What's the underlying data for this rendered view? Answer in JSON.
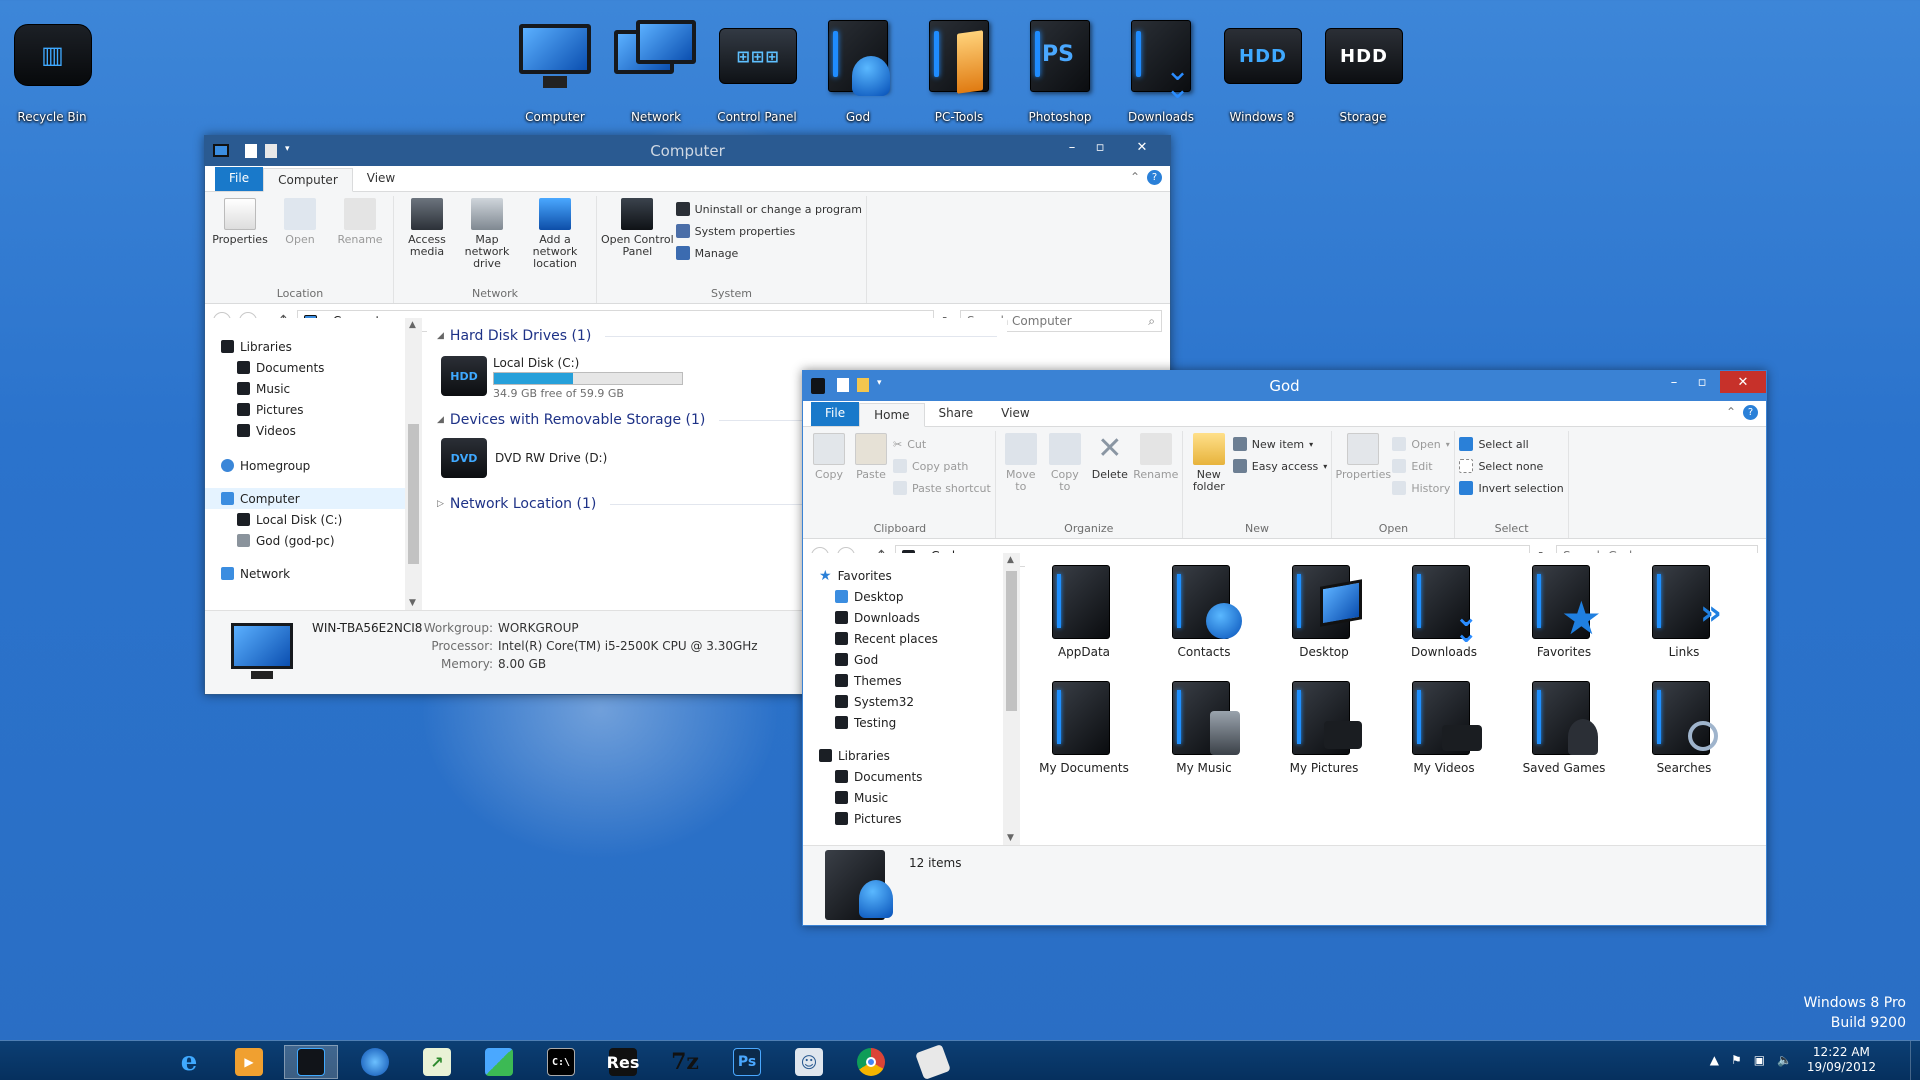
{
  "desktop": {
    "icons": [
      {
        "label": "Recycle Bin"
      },
      {
        "label": "Computer"
      },
      {
        "label": "Network"
      },
      {
        "label": "Control Panel"
      },
      {
        "label": "God"
      },
      {
        "label": "PC-Tools"
      },
      {
        "label": "Photoshop"
      },
      {
        "label": "Downloads"
      },
      {
        "label": "Windows 8"
      },
      {
        "label": "Storage"
      }
    ],
    "hdd_text": "HDD",
    "ps_text": "PS",
    "watermark_line1": "Windows 8 Pro",
    "watermark_line2": "Build 9200"
  },
  "computer_window": {
    "title": "Computer",
    "tabs": [
      "File",
      "Computer",
      "View"
    ],
    "ribbon": {
      "location": {
        "name": "Location",
        "items": [
          "Properties",
          "Open",
          "Rename"
        ]
      },
      "network": {
        "name": "Network",
        "items": [
          "Access media",
          "Map network drive",
          "Add a network location"
        ]
      },
      "system": {
        "name": "System",
        "big": "Open Control Panel",
        "small": [
          "Uninstall or change a program",
          "System properties",
          "Manage"
        ]
      }
    },
    "address": "Computer",
    "search_placeholder": "Search Computer",
    "nav": {
      "libraries": "Libraries",
      "lib_items": [
        "Documents",
        "Music",
        "Pictures",
        "Videos"
      ],
      "homegroup": "Homegroup",
      "computer": "Computer",
      "computer_items": [
        "Local Disk (C:)",
        "God (god-pc)"
      ],
      "network": "Network"
    },
    "groups": {
      "hdd": "Hard Disk Drives (1)",
      "removable": "Devices with Removable Storage (1)",
      "netloc": "Network Location (1)"
    },
    "local_disk": {
      "name": "Local Disk (C:)",
      "free_text": "34.9 GB free of 59.9 GB",
      "used_fraction": 0.42,
      "icon_text": "HDD"
    },
    "dvd": {
      "name": "DVD RW Drive (D:)",
      "icon_text": "DVD"
    },
    "details": {
      "pc_name": "WIN-TBA56E2NCI8",
      "workgroup_label": "Workgroup:",
      "workgroup": "WORKGROUP",
      "processor_label": "Processor:",
      "processor": "Intel(R) Core(TM) i5-2500K CPU @ 3.30GHz",
      "memory_label": "Memory:",
      "memory": "8.00 GB"
    }
  },
  "god_window": {
    "title": "God",
    "tabs": [
      "File",
      "Home",
      "Share",
      "View"
    ],
    "ribbon": {
      "clipboard": {
        "name": "Clipboard",
        "big": [
          "Copy",
          "Paste"
        ],
        "small": [
          "Cut",
          "Copy path",
          "Paste shortcut"
        ]
      },
      "organize": {
        "name": "Organize",
        "items": [
          "Move to",
          "Copy to",
          "Delete",
          "Rename"
        ]
      },
      "new": {
        "name": "New",
        "big": "New folder",
        "small": [
          "New item",
          "Easy access"
        ]
      },
      "open": {
        "name": "Open",
        "big": "Properties",
        "small": [
          "Open",
          "Edit",
          "History"
        ]
      },
      "select": {
        "name": "Select",
        "small": [
          "Select all",
          "Select none",
          "Invert selection"
        ]
      }
    },
    "address": "God",
    "search_placeholder": "Search God",
    "nav": {
      "favorites": "Favorites",
      "fav_items": [
        "Desktop",
        "Downloads",
        "Recent places",
        "God",
        "Themes",
        "System32",
        "Testing"
      ],
      "libraries": "Libraries",
      "lib_items": [
        "Documents",
        "Music",
        "Pictures"
      ]
    },
    "files": [
      "AppData",
      "Contacts",
      "Desktop",
      "Downloads",
      "Favorites",
      "Links",
      "My Documents",
      "My Music",
      "My Pictures",
      "My Videos",
      "Saved Games",
      "Searches"
    ],
    "status": "12 items"
  },
  "taskbar": {
    "apps": [
      "internet-explorer",
      "media-player",
      "explorer",
      "network-tool",
      "task-manager",
      "remote-desktop",
      "command-prompt",
      "res",
      "7zip",
      "photoshop",
      "user-manager",
      "chrome",
      "notes"
    ],
    "res_text": "Res",
    "sevenzip_text": "7z",
    "ps_text": "Ps",
    "cmd_text": "C:\\",
    "clock_time": "12:22 AM",
    "clock_date": "19/09/2012"
  },
  "colors": {
    "accent": "#1979ca",
    "title_dark": "#2a5a91",
    "title_active": "#3a82d4",
    "close": "#c7312a"
  }
}
